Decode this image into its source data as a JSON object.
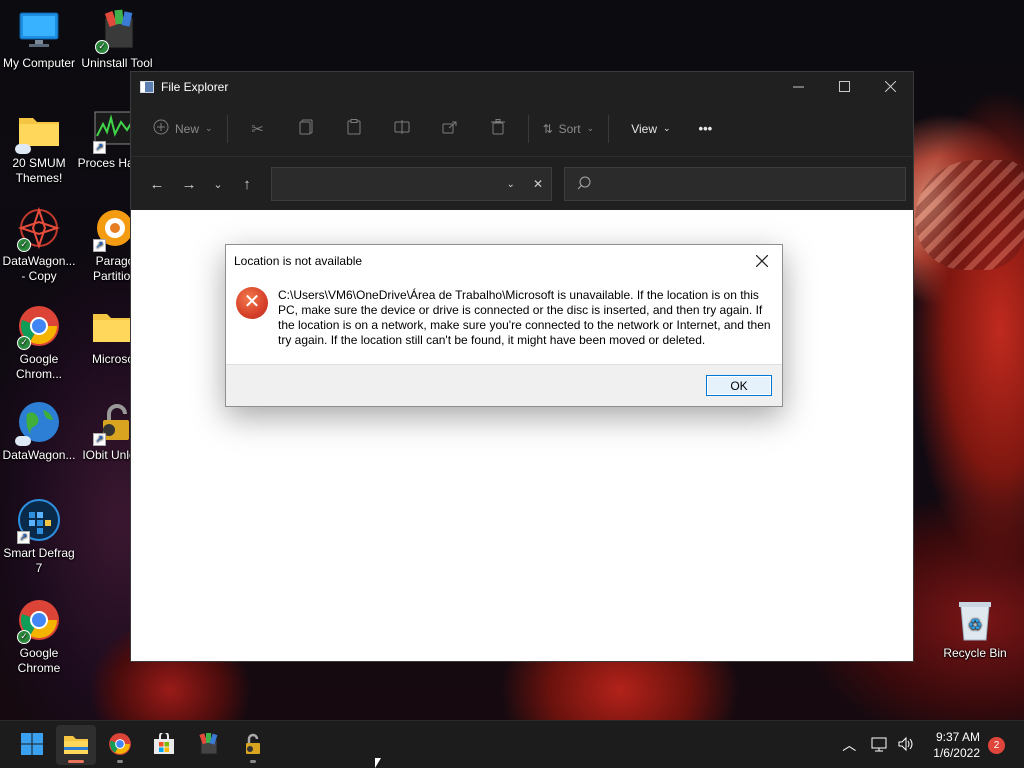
{
  "desktop": {
    "icons": [
      {
        "label": "My Computer",
        "icon": "computer-icon"
      },
      {
        "label": "Uninstall Tool",
        "icon": "uninstall-tool-icon"
      },
      {
        "label": "20 SMUM Themes!",
        "icon": "folder-icon"
      },
      {
        "label": "Proces Hacke",
        "icon": "process-hacker-icon"
      },
      {
        "label": "DataWagon... - Copy",
        "icon": "datawagon-icon"
      },
      {
        "label": "Parago Partition",
        "icon": "paragon-icon"
      },
      {
        "label": "Google Chrom...",
        "icon": "chrome-icon"
      },
      {
        "label": "Microso",
        "icon": "folder-icon"
      },
      {
        "label": "DataWagon...",
        "icon": "globe-icon"
      },
      {
        "label": "IObit Unlock",
        "icon": "iobit-unlocker-icon"
      },
      {
        "label": "Smart Defrag 7",
        "icon": "smart-defrag-icon"
      },
      {
        "label": "Google Chrome",
        "icon": "chrome-icon"
      },
      {
        "label": "Recycle Bin",
        "icon": "recycle-bin-icon"
      }
    ]
  },
  "explorer": {
    "title": "File Explorer",
    "toolbar": {
      "new_label": "New",
      "sort_label": "Sort",
      "view_label": "View",
      "more_label": "•••"
    },
    "address": {
      "value": ""
    },
    "search": {
      "placeholder": ""
    }
  },
  "dialog": {
    "title": "Location is not available",
    "message": "C:\\Users\\VM6\\OneDrive\\Área de Trabalho\\Microsoft is unavailable. If the location is on this PC, make sure the device or drive is connected or the disc is inserted, and then try again. If the location is on a network, make sure you're connected to the network or Internet, and then try again. If the location still can't be found, it might have been moved or deleted.",
    "ok_label": "OK"
  },
  "taskbar": {
    "apps": [
      "start-icon",
      "file-explorer-icon",
      "chrome-icon",
      "store-icon",
      "winrar-icon",
      "unlocker-icon"
    ],
    "clock": {
      "time": "9:37 AM",
      "date": "1/6/2022"
    },
    "notification_count": "2"
  },
  "colors": {
    "accent": "#0078d7",
    "error": "#d6402a",
    "explorer_bg": "#202020"
  }
}
